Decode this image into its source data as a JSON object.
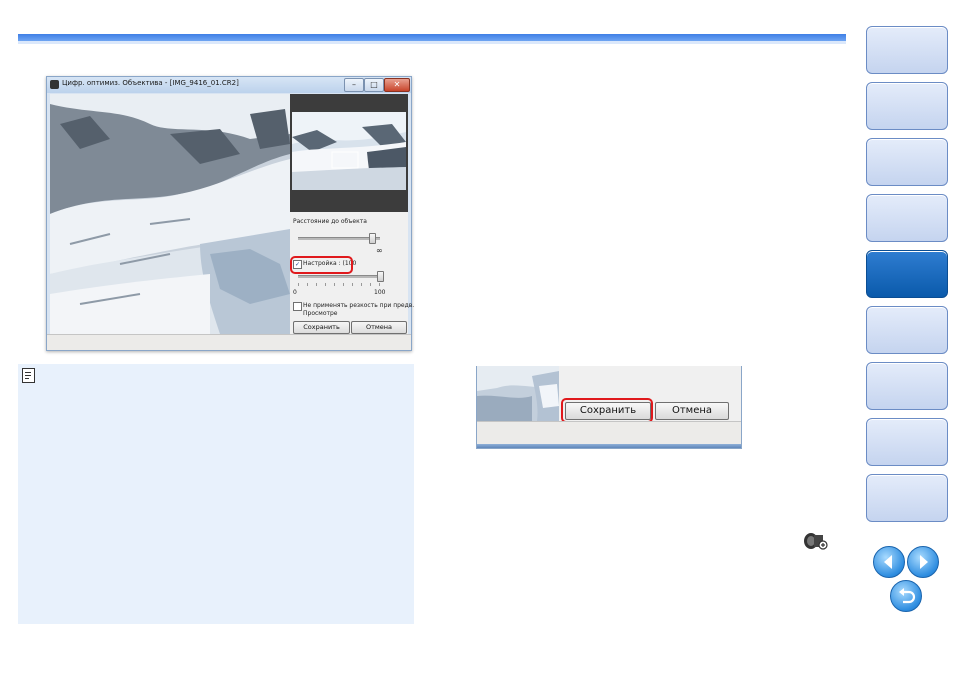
{
  "dialog": {
    "title": "Цифр. оптимиз. Объектива - [IMG_9416_01.CR2]",
    "window_buttons": [
      "–",
      "□",
      "✕"
    ],
    "distance_label": "Расстояние до объекта",
    "distance_value": "∞",
    "distance_level": 0.9,
    "adjust_label": "Настройка : (100",
    "adjust_level": 1.0,
    "range_min": "0",
    "range_max": "100",
    "no_sharpness_label": "Не применять резкость при предв.",
    "no_sharpness_label2": "Просмотре",
    "save_label": "Сохранить",
    "cancel_label": "Отмена"
  },
  "crop": {
    "save_label": "Сохранить",
    "cancel_label": "Отмена"
  },
  "nav": {
    "tab_count": 9,
    "active_index": 4
  },
  "colors": {
    "accent": "#3f7fe6",
    "highlight": "#e0191c",
    "active_tab": "#0a5aab",
    "note_bg": "#e8f1fc"
  },
  "icons": [
    "memo-icon",
    "lens-icon",
    "prev-page-icon",
    "next-page-icon",
    "back-icon"
  ]
}
